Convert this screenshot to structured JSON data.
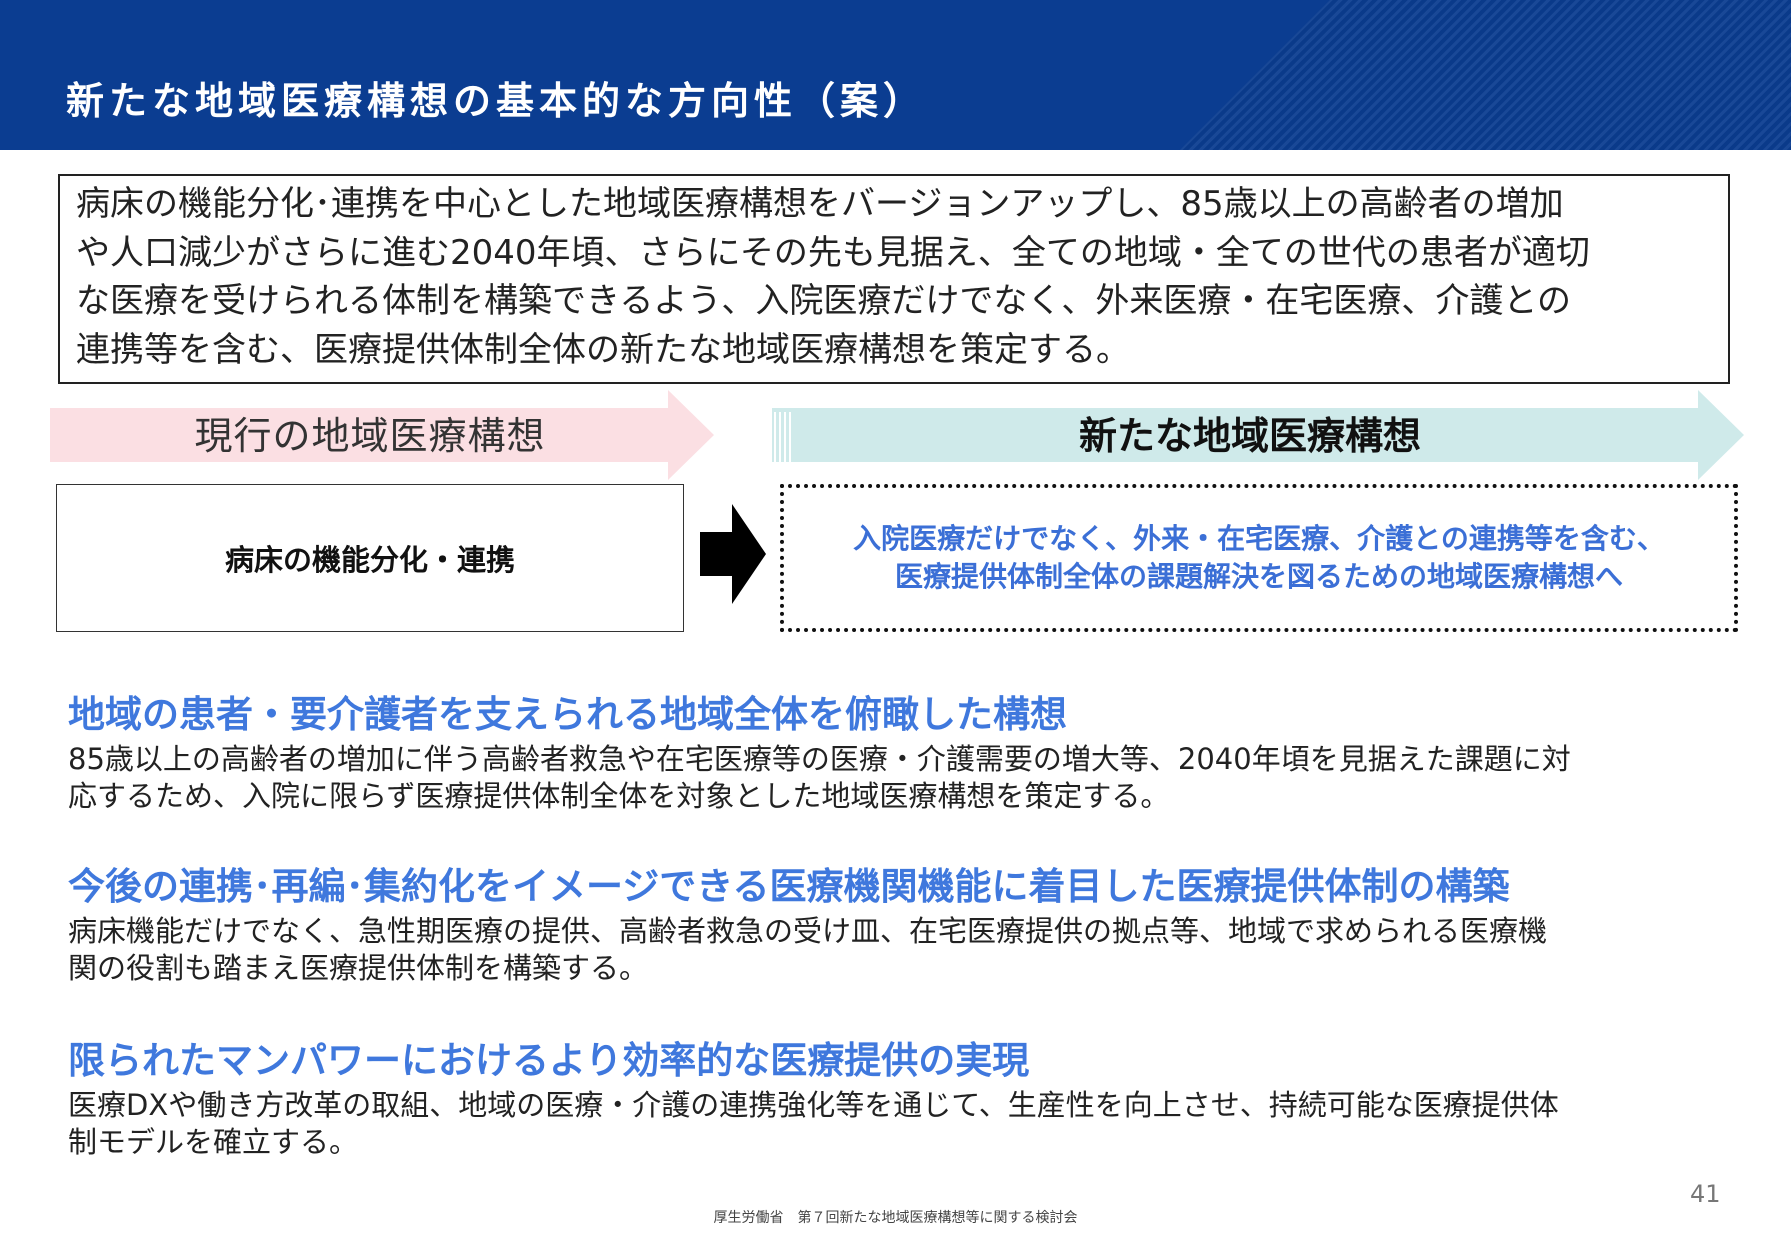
{
  "header": {
    "title": "新たな地域医療構想の基本的な方向性（案）"
  },
  "intro": {
    "lines": [
      "病床の機能分化･連携を中心とした地域医療構想をバージョンアップし、85歳以上の高齢者の増加",
      "や人口減少がさらに進む2040年頃、さらにその先も見据え、全ての地域・全ての世代の患者が適切",
      "な医療を受けられる体制を構築できるよう、入院医療だけでなく、外来医療・在宅医療、介護との",
      "連携等を含む、医療提供体制全体の新たな地域医療構想を策定する。"
    ]
  },
  "comparison": {
    "current_label": "現行の地域医療構想",
    "new_label": "新たな地域医療構想",
    "current_box": "病床の機能分化・連携",
    "new_box_lines": [
      "入院医療だけでなく、外来・在宅医療、介護との連携等を含む、",
      "医療提供体制全体の課題解決を図るための地域医療構想へ"
    ]
  },
  "sections": [
    {
      "title": "地域の患者・要介護者を支えられる地域全体を俯瞰した構想",
      "body_lines": [
        "85歳以上の高齢者の増加に伴う高齢者救急や在宅医療等の医療・介護需要の増大等、2040年頃を見据えた課題に対",
        "応するため、入院に限らず医療提供体制全体を対象とした地域医療構想を策定する。"
      ]
    },
    {
      "title": "今後の連携･再編･集約化をイメージできる医療機関機能に着目した医療提供体制の構築",
      "body_lines": [
        "病床機能だけでなく、急性期医療の提供、高齢者救急の受け皿、在宅医療提供の拠点等、地域で求められる医療機",
        "関の役割も踏まえ医療提供体制を構築する。"
      ]
    },
    {
      "title": "限られたマンパワーにおけるより効率的な医療提供の実現",
      "body_lines": [
        "医療DXや働き方改革の取組、地域の医療・介護の連携強化等を通じて、生産性を向上させ、持続可能な医療提供体",
        "制モデルを確立する。"
      ]
    }
  ],
  "page_number": "41",
  "footer": "厚生労働省　第７回新たな地域医療構想等に関する検討会",
  "colors": {
    "header_bg": "#0b3d91",
    "accent_blue": "#3f78dd",
    "current_band": "#fbdfe3",
    "new_band": "#cfeaea"
  }
}
